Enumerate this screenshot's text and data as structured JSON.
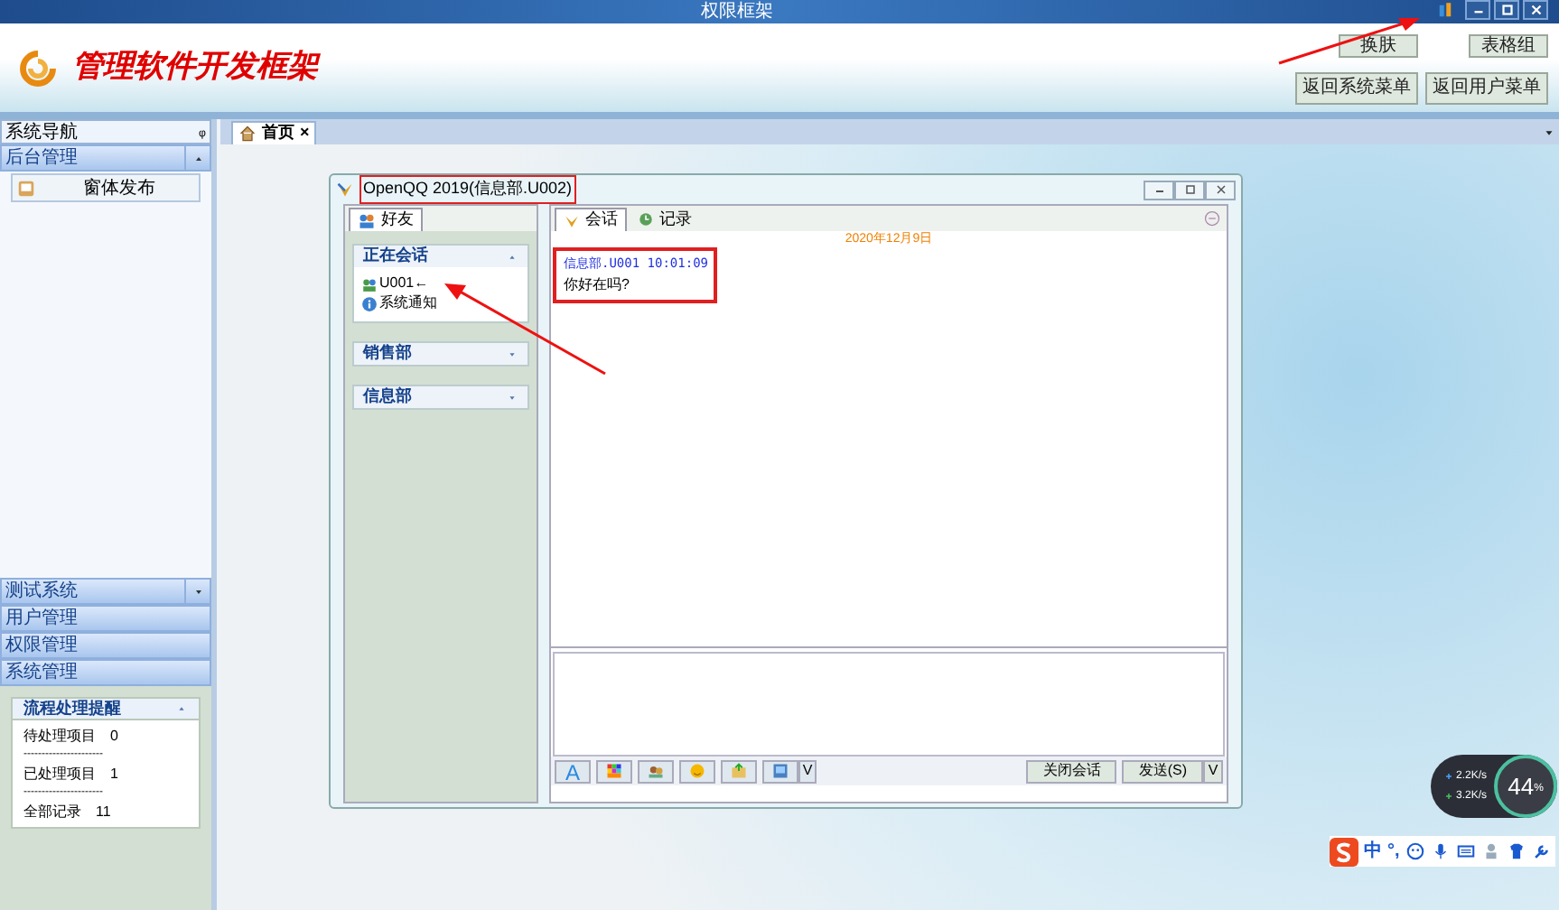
{
  "window": {
    "title": "权限框架"
  },
  "header": {
    "logo_text": "管理软件开发框架",
    "buttons": [
      {
        "label": "换肤"
      },
      {
        "label": "表格组"
      },
      {
        "label": "返回系统菜单"
      },
      {
        "label": "返回用户菜单"
      }
    ]
  },
  "sidebar": {
    "title": "系统导航",
    "pin": "ᵩ",
    "groups": [
      {
        "label": "后台管理",
        "expanded": true,
        "items": [
          {
            "label": "窗体发布"
          }
        ]
      },
      {
        "label": "测试系统",
        "expanded": false
      },
      {
        "label": "用户管理"
      },
      {
        "label": "权限管理"
      },
      {
        "label": "系统管理"
      }
    ],
    "reminder": {
      "title": "流程处理提醒",
      "rows": [
        {
          "label": "待处理项目",
          "value": "0"
        },
        {
          "label": "已处理项目",
          "value": "1"
        },
        {
          "label": "全部记录",
          "value": "11"
        }
      ],
      "separator": "----------------------"
    }
  },
  "tabs": [
    {
      "label": "首页",
      "close": "×",
      "selected": true
    }
  ],
  "chat_window": {
    "title": "OpenQQ 2019(信息部.U002)",
    "left_tab": {
      "label": "好友",
      "selected": true
    },
    "sections": [
      {
        "label": "正在会话",
        "expanded": true,
        "items": [
          {
            "label": "U001←",
            "kind": "user"
          },
          {
            "label": "系统通知",
            "kind": "info"
          }
        ]
      },
      {
        "label": "销售部",
        "expanded": false
      },
      {
        "label": "信息部",
        "expanded": false
      }
    ],
    "right_tabs": [
      {
        "label": "会话",
        "selected": true
      },
      {
        "label": "记录",
        "selected": false
      }
    ],
    "date": "2020年12月9日",
    "messages": [
      {
        "sender": "信息部.U001  10:01:09",
        "text": "你好在吗?"
      }
    ],
    "toolbar": [
      "A",
      "V"
    ],
    "buttons": [
      {
        "label": "关闭会话"
      },
      {
        "label": "发送(S)"
      },
      {
        "label": "V"
      }
    ]
  },
  "net_widget": {
    "rows": [
      {
        "value": "2.2",
        "unit": "K/s"
      },
      {
        "value": "3.2",
        "unit": "K/s"
      }
    ],
    "percent": "44",
    "percent_unit": "%"
  },
  "ime_bar": {
    "items": [
      "中",
      "°,"
    ]
  }
}
